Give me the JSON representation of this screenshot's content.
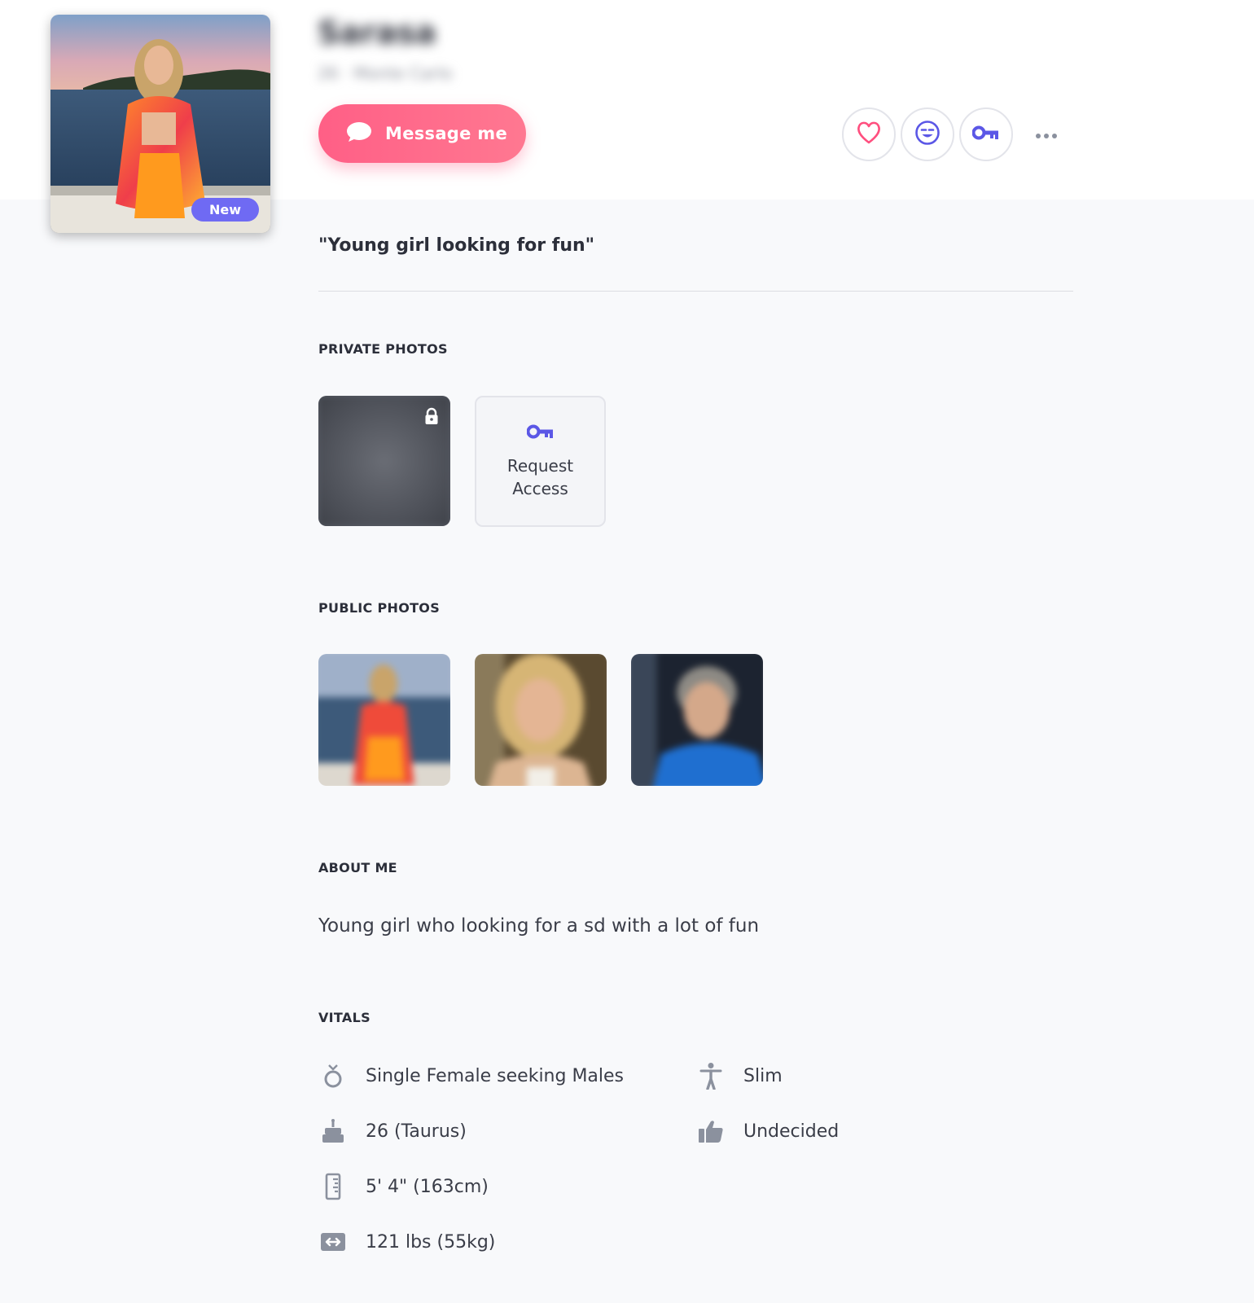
{
  "profile": {
    "badge": "New",
    "name": "Sarasa",
    "subline": "26 · Monte Carlo"
  },
  "actions": {
    "message_label": "Message me",
    "favorite_icon": "heart-icon",
    "wink_icon": "wink-face-icon",
    "key_icon": "key-icon",
    "more_icon": "more-dots-icon"
  },
  "tagline": "\"Young girl looking for fun\"",
  "sections": {
    "private_photos": "PRIVATE PHOTOS",
    "public_photos": "PUBLIC PHOTOS",
    "about_me": "ABOUT ME",
    "vitals": "VITALS"
  },
  "private": {
    "request_label": "Request Access"
  },
  "about": {
    "text": "Young girl who looking for a sd with a lot of fun"
  },
  "vitals": {
    "relationship": "Single Female seeking Males",
    "age": "26 (Taurus)",
    "height": "5' 4\" (163cm)",
    "weight": "121 lbs (55kg)",
    "body": "Slim",
    "preference": "Undecided"
  },
  "colors": {
    "accent_pink": "#ff5f86",
    "accent_purple": "#5b57e6",
    "badge_purple": "#6f6af3",
    "icon_gray": "#8b919e"
  }
}
